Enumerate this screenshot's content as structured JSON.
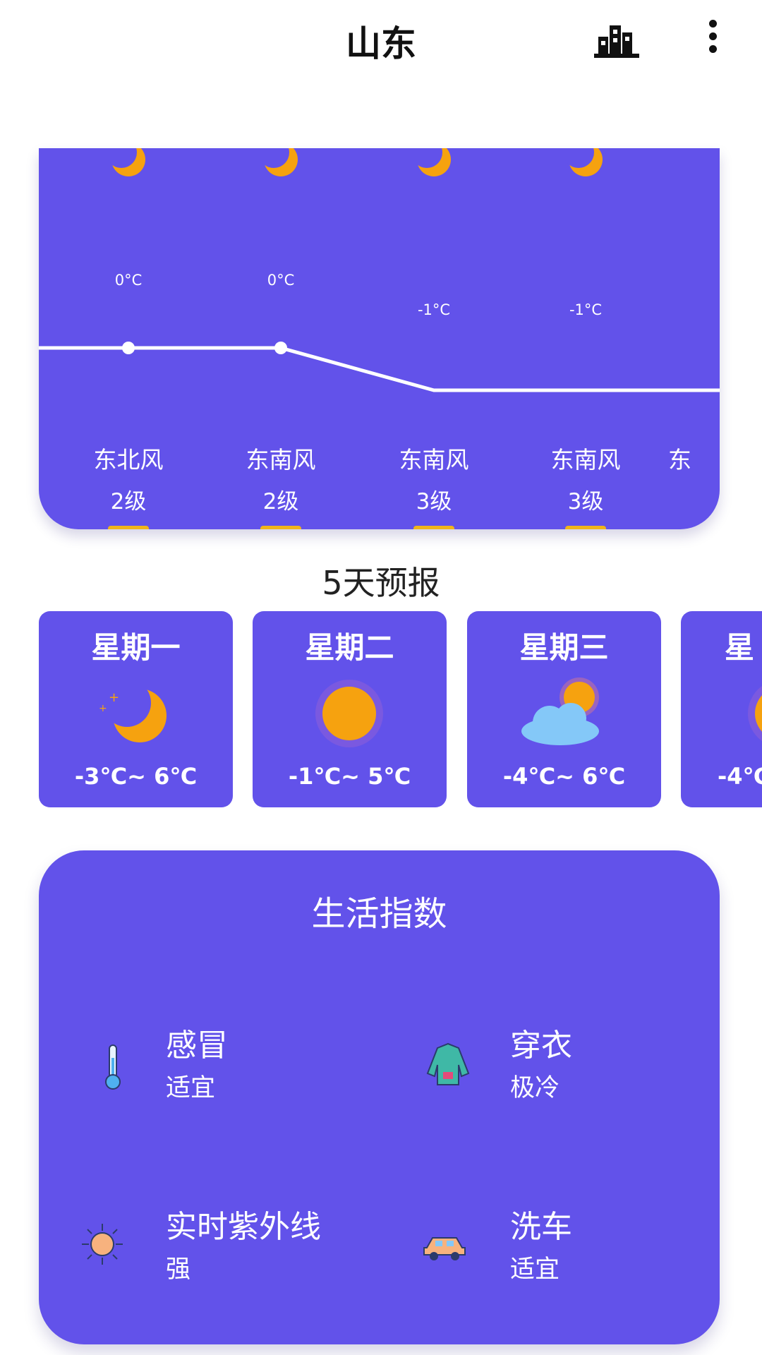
{
  "header": {
    "title": "山东",
    "city_icon": "city-buildings-icon",
    "more_icon": "more-vertical-icon"
  },
  "hourly": {
    "temps": [
      "0°C",
      "0°C",
      "-1°C",
      "-1°C"
    ],
    "winds": [
      {
        "dir": "东北风",
        "level": "2级"
      },
      {
        "dir": "东南风",
        "level": "2级"
      },
      {
        "dir": "东南风",
        "level": "3级"
      },
      {
        "dir": "东南风",
        "level": "3级"
      },
      {
        "dir": "东",
        "level": ""
      }
    ],
    "icon": "moon-icon"
  },
  "forecast": {
    "title": "5天预报",
    "days": [
      {
        "name": "星期一",
        "icon": "moon-icon",
        "temp": "-3℃~ 6℃"
      },
      {
        "name": "星期二",
        "icon": "sun-icon",
        "temp": "-1℃~ 5℃"
      },
      {
        "name": "星期三",
        "icon": "cloud-sun-icon",
        "temp": "-4℃~ 6℃"
      },
      {
        "name": "星",
        "icon": "sun-icon",
        "temp": "-4℃"
      }
    ]
  },
  "life": {
    "title": "生活指数",
    "items": [
      {
        "name": "感冒",
        "value": "适宜",
        "icon": "thermometer-icon"
      },
      {
        "name": "穿衣",
        "value": "极冷",
        "icon": "jacket-icon"
      },
      {
        "name": "实时紫外线",
        "value": "强",
        "icon": "uv-sun-icon"
      },
      {
        "name": "洗车",
        "value": "适宜",
        "icon": "car-icon"
      }
    ]
  },
  "colors": {
    "card": "#6252ea",
    "accent": "#f6a20f",
    "cloud": "#84c8f8"
  }
}
